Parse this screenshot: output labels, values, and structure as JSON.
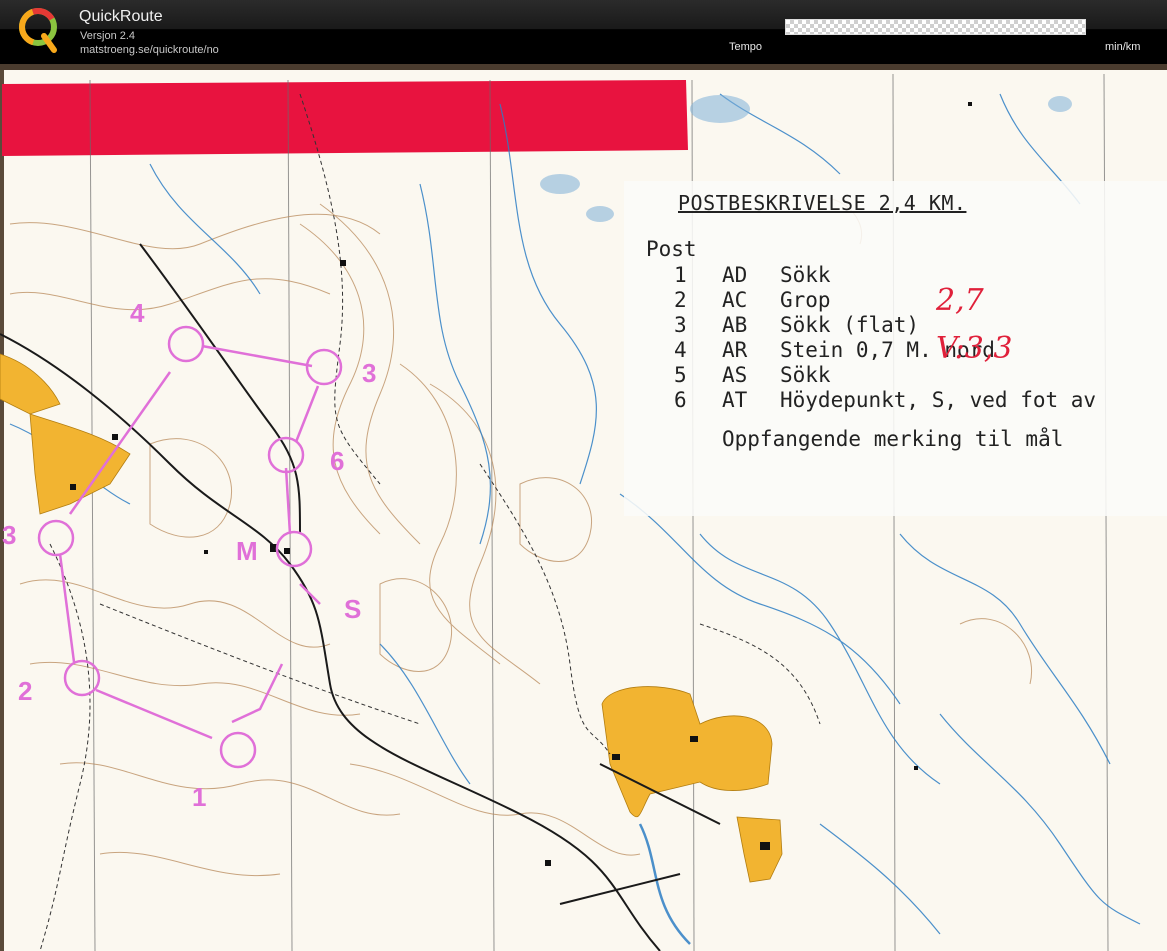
{
  "app": {
    "title": "QuickRoute",
    "version": "Versjon 2.4",
    "url": "matstroeng.se/quickroute/no",
    "logo_letter": "Q"
  },
  "toolbar": {
    "tempo_label": "Tempo",
    "unit_label": "min/km"
  },
  "legend": {
    "title": "POSTBESKRIVELSE  2,4 KM.",
    "header": "Post",
    "rows": [
      {
        "num": "1",
        "code": "AD",
        "desc": "Sökk"
      },
      {
        "num": "2",
        "code": "AC",
        "desc": "Grop"
      },
      {
        "num": "3",
        "code": "AB",
        "desc": "Sökk (flat)"
      },
      {
        "num": "4",
        "code": "AR",
        "desc": "Stein 0,7 M. nord"
      },
      {
        "num": "5",
        "code": "AS",
        "desc": "Sökk"
      },
      {
        "num": "6",
        "code": "AT",
        "desc": "Höydepunkt, S, ved fot av"
      }
    ],
    "footer": "Oppfangende merking til mål",
    "handwritten": [
      "2,7",
      "V:3,3"
    ]
  },
  "controls": {
    "labels": [
      "4",
      "3",
      "6",
      "M",
      "S",
      "3",
      "2",
      "1"
    ]
  },
  "colors": {
    "course": "#e070d8",
    "red_tape": "#e8133f",
    "settlement": "#f2b431",
    "water": "#2d7ec4",
    "contour": "#b8895a",
    "paper": "#fbf8f0"
  }
}
